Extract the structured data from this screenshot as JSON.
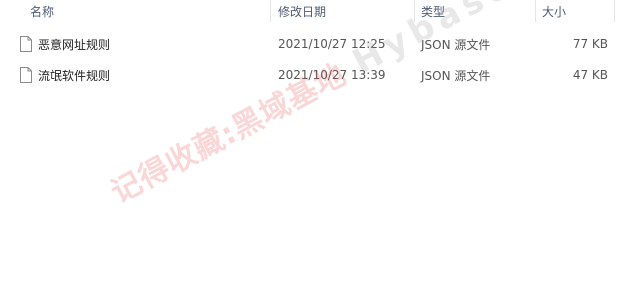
{
  "header": {
    "columns": {
      "name": "名称",
      "date": "修改日期",
      "type": "类型",
      "size": "大小"
    },
    "sort_indicator": "^"
  },
  "files": [
    {
      "name": "恶意网址规则",
      "date": "2021/10/27 12:25",
      "type": "JSON 源文件",
      "size": "77 KB",
      "icon": "document-icon"
    },
    {
      "name": "流氓软件规则",
      "date": "2021/10/27 13:39",
      "type": "JSON 源文件",
      "size": "47 KB",
      "icon": "document-icon"
    }
  ],
  "watermark": {
    "text_cn": "记得收藏:黑域基地",
    "text_en": "Hybase.com"
  },
  "colors": {
    "header_text": "#4d5b74",
    "text": "#1f1f1f",
    "secondary_text": "#555555",
    "separator": "#e5e5e5",
    "watermark_red": "#e84a4a",
    "watermark_gray": "#969696"
  }
}
